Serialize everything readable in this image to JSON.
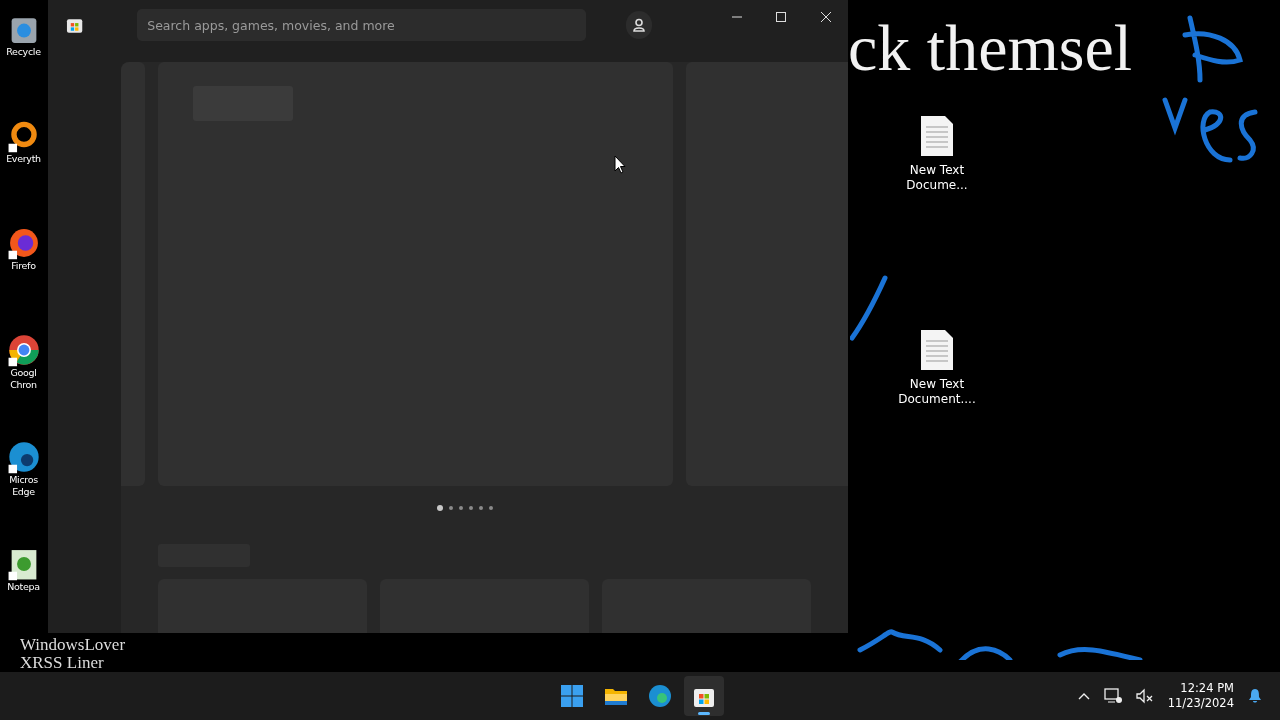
{
  "wallpaper_texts": [
    {
      "text": "ck themsel",
      "kind": "big"
    },
    {
      "text": "WindowsLover",
      "kind": "bottom"
    },
    {
      "text": "XRSS Liner",
      "kind": "bottom"
    }
  ],
  "desktop_icons": [
    {
      "label": "Recycle",
      "kind": "recycle",
      "shortcut": false
    },
    {
      "label": "Everyth",
      "kind": "everything",
      "shortcut": true
    },
    {
      "label": "Firefo",
      "kind": "firefox",
      "shortcut": true
    },
    {
      "label": "Googl Chron",
      "kind": "chrome",
      "shortcut": true
    },
    {
      "label": "Micros Edge",
      "kind": "edge",
      "shortcut": true
    },
    {
      "label": "Notepa",
      "kind": "notepad",
      "shortcut": true
    }
  ],
  "right_icons": [
    {
      "label": "New Text Docume..."
    },
    {
      "label": "New Text Document...."
    }
  ],
  "store_window": {
    "search": {
      "placeholder": "Search apps, games, movies, and more"
    },
    "carousel_dots": [
      {
        "selected": true
      },
      {
        "selected": false
      },
      {
        "selected": false
      },
      {
        "selected": false
      },
      {
        "selected": false
      },
      {
        "selected": false
      }
    ]
  },
  "taskbar": {
    "apps": [
      {
        "kind": "start",
        "selected": false
      },
      {
        "kind": "explorer",
        "selected": false
      },
      {
        "kind": "edge",
        "selected": false
      },
      {
        "kind": "store",
        "selected": true
      }
    ],
    "time": "12:24 PM",
    "date": "11/23/2024"
  }
}
